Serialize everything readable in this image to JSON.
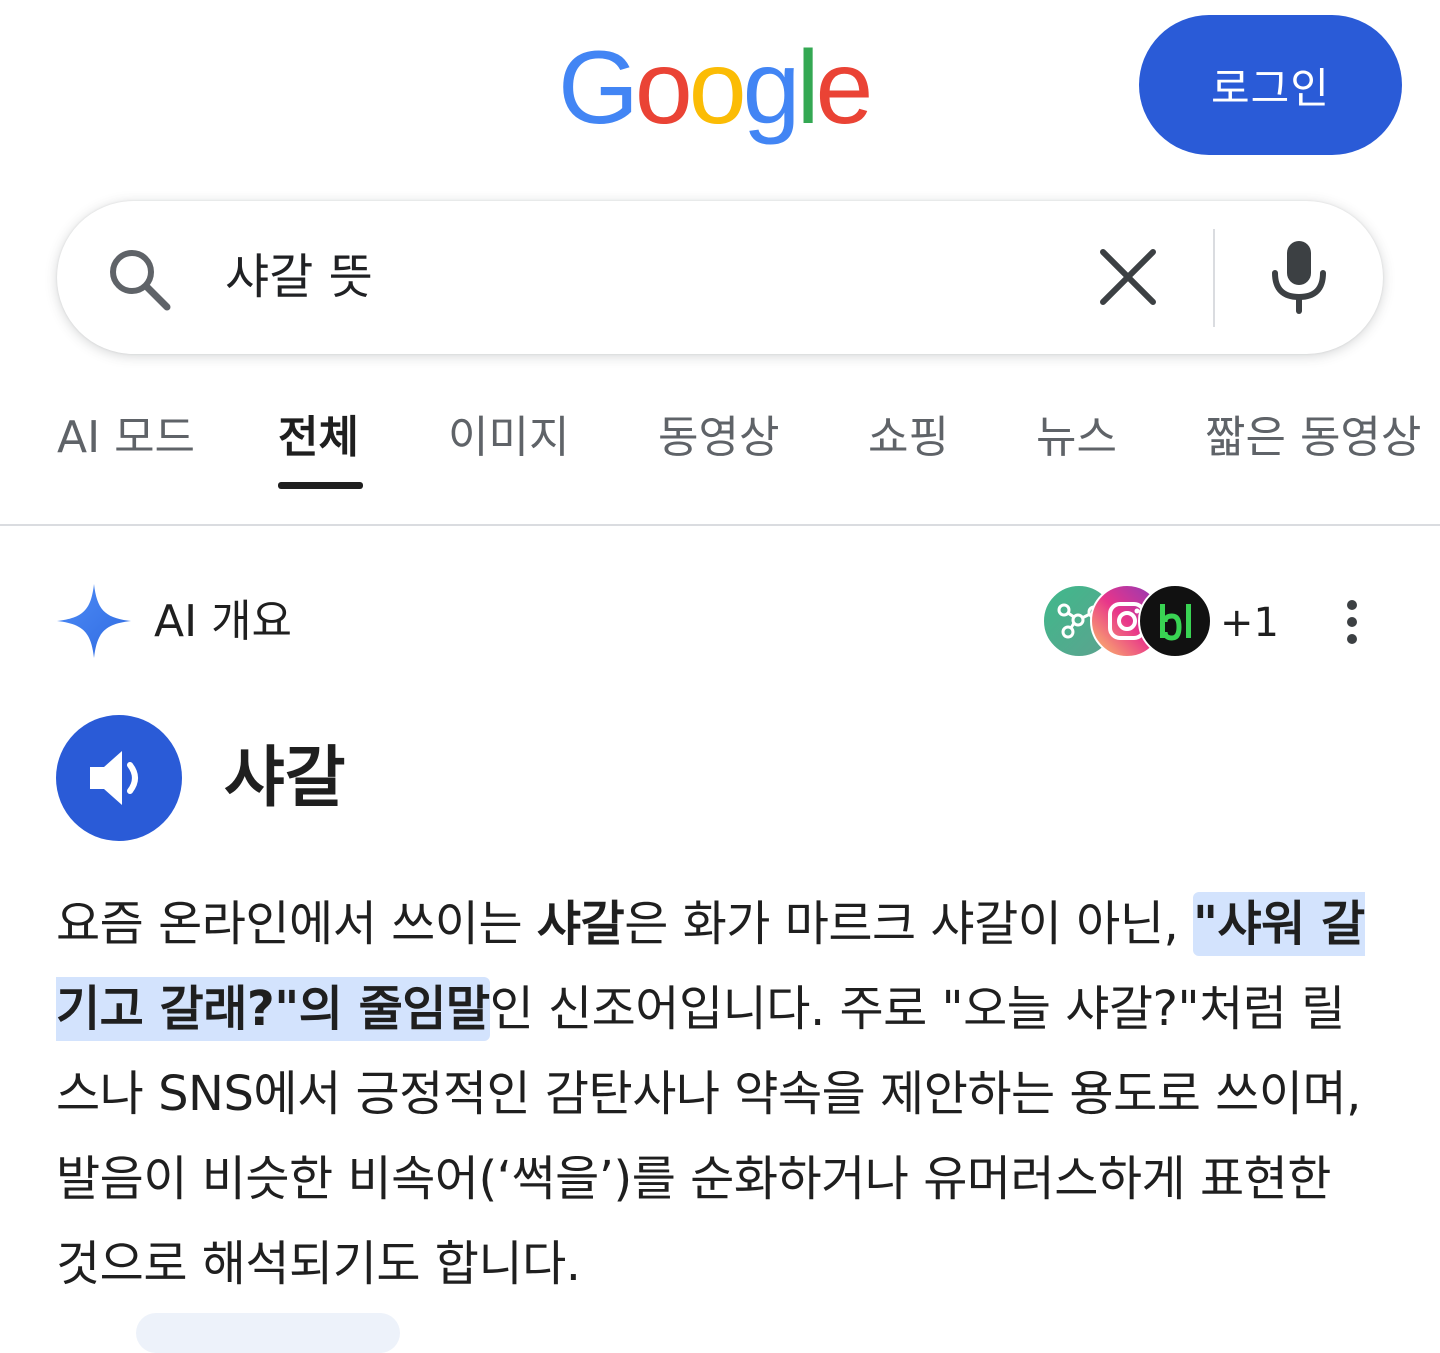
{
  "header": {
    "logo_letters": [
      "G",
      "o",
      "o",
      "g",
      "l",
      "e"
    ],
    "login_label": "로그인"
  },
  "search": {
    "query": "샤갈 뜻",
    "icons": [
      "search-icon",
      "clear-icon",
      "mic-icon"
    ]
  },
  "tabs": [
    {
      "label": "AI 모드",
      "active": false
    },
    {
      "label": "전체",
      "active": true
    },
    {
      "label": "이미지",
      "active": false
    },
    {
      "label": "동영상",
      "active": false
    },
    {
      "label": "쇼핑",
      "active": false
    },
    {
      "label": "뉴스",
      "active": false
    },
    {
      "label": "짧은 동영상",
      "active": false
    }
  ],
  "ai_overview": {
    "title": "AI 개요",
    "source_count": "+1",
    "term": "샤갈",
    "paragraph": {
      "p1": "요즘 온라인에서 쓰이는 ",
      "term_bold": "샤갈",
      "p2": "은 화가 마르크 샤갈이 아닌, ",
      "highlight": "\"샤워 갈기고 갈래?\"의 줄임말",
      "p3": "인 신조어입니다. 주로 \"오늘 샤갈?\"처럼 릴스나 SNS에서 긍정적인 감탄사나 약속을 제안하는 용도로 쓰이며, 발음이 비슷한 비속어(‘썩을’)를 순화하거나 유머러스하게 표현한 것으로 해석되기도 합니다."
    }
  },
  "colors": {
    "accent": "#2a5bd7",
    "highlight": "#d3e3fd",
    "google_blue": "#4285F4",
    "google_red": "#EA4335",
    "google_yellow": "#FBBC05",
    "google_green": "#34A853"
  }
}
